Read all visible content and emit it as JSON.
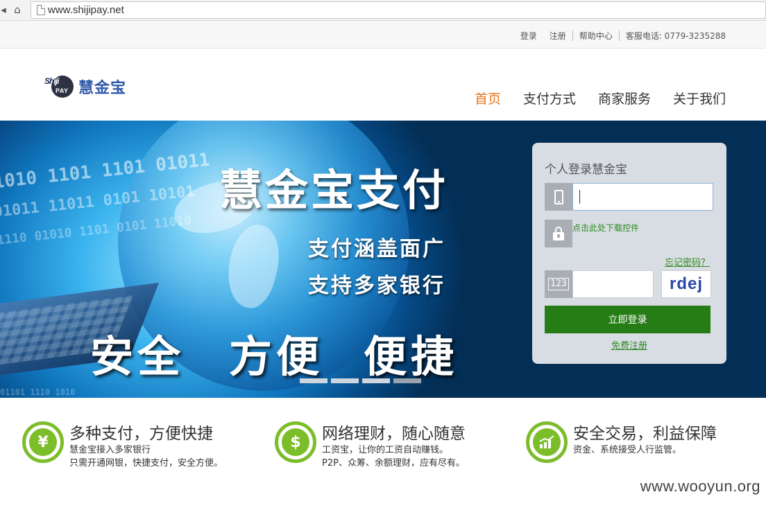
{
  "browser": {
    "url": "www.shijipay.net"
  },
  "util_bar": {
    "login": "登录",
    "register": "注册",
    "help": "帮助中心",
    "hotline": "客服电话: 0779-3235288"
  },
  "header": {
    "logo": {
      "shi": "Sh",
      "ji": "iji",
      "pay": "PAY",
      "cn": "慧金宝"
    },
    "nav": [
      {
        "label": "首页",
        "active": true
      },
      {
        "label": "支付方式",
        "active": false
      },
      {
        "label": "商家服务",
        "active": false
      },
      {
        "label": "关于我们",
        "active": false
      }
    ]
  },
  "banner": {
    "title": "慧金宝支付",
    "subtitle1": "支付涵盖面广",
    "subtitle2": "支持多家银行",
    "slogan": [
      "安全",
      "方便",
      "便捷"
    ],
    "slide_count": 4,
    "active_slide": 4
  },
  "login_panel": {
    "title": "个人登录慧金宝",
    "phone_value": "",
    "download_link": "点击此处下载控件",
    "forgot_link": "忘记密码？",
    "code_value": "",
    "captcha_text": "rdej",
    "login_button": "立即登录",
    "register_link": "免费注册"
  },
  "features": [
    {
      "icon": "yen-icon",
      "title": "多种支付，方便快捷",
      "line1": "慧金宝接入多家银行",
      "line2": "只需开通网银，快捷支付，安全方便。"
    },
    {
      "icon": "money-bag-icon",
      "title": "网络理财，随心随意",
      "line1": "工资宝，让你的工资自动赚钱。",
      "line2": "P2P、众筹、余额理财，应有尽有。"
    },
    {
      "icon": "growth-chart-icon",
      "title": "安全交易，利益保障",
      "line1": "资金、系统接受人行监管。",
      "line2": ""
    }
  ],
  "watermark": "www.wooyun.org",
  "colors": {
    "accent_orange": "#e8741a",
    "green": "#267d16",
    "feature_green": "#7cbd2a",
    "banner_navy": "#032e55"
  }
}
